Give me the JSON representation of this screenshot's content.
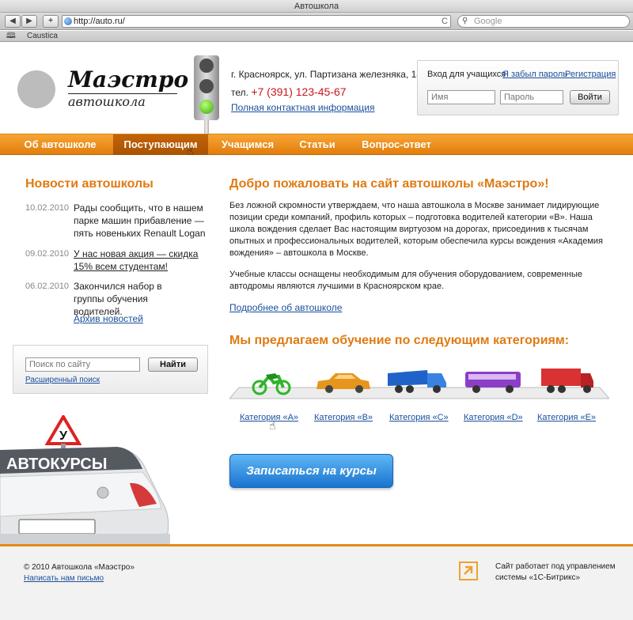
{
  "browser": {
    "window_title": "Автошкола",
    "back_glyph": "◀",
    "forward_glyph": "▶",
    "add_glyph": "+",
    "url": "http://auto.ru/",
    "reload_glyph": "C",
    "search_placeholder": "Google",
    "bookmark": "Caustica"
  },
  "header": {
    "logo_title": "Маэстро",
    "logo_subtitle": "автошкола",
    "address": "г. Красноярск, ул. Партизана железняка, 18",
    "phone_label": "тел.",
    "phone_number": "+7 (391) 123-45-67",
    "contacts_link": "Полная контактная информация"
  },
  "login": {
    "title": "Вход для учащихся",
    "forgot_link": "Я забыл пароль",
    "register_link": "Регистрация",
    "name_placeholder": "Имя",
    "password_placeholder": "Пароль",
    "submit_label": "Войти"
  },
  "nav": {
    "items": [
      {
        "label": "Об автошколе"
      },
      {
        "label": "Поступающим"
      },
      {
        "label": "Учащимся"
      },
      {
        "label": "Статьи"
      },
      {
        "label": "Вопрос-ответ"
      }
    ],
    "active_index": 1
  },
  "news": {
    "title": "Новости автошколы",
    "items": [
      {
        "date": "10.02.2010",
        "text": "Рады сообщить, что в нашем парке машин прибавление — пять новеньких Renault Logan"
      },
      {
        "date": "09.02.2010",
        "text": "У нас новая акция — скидка 15% всем студентам!"
      },
      {
        "date": "06.02.2010",
        "text": "Закончился набор в группы обучения водителей."
      }
    ],
    "archive_link": "Архив новостей"
  },
  "search": {
    "placeholder": "Поиск по сайту",
    "button": "Найти",
    "advanced_link": "Расширенный поиск"
  },
  "car": {
    "roof_sign": "У",
    "windshield_text": "АВТОКУРСЫ"
  },
  "main": {
    "welcome_title": "Добро пожаловать на сайт автошколы «Маэстро»!",
    "paragraph1": "Без ложной скромности утверждаем, что наша автошкола в Москве занимает лидирующие позиции среди компаний, профиль которых – подготовка водителей категории «В». Наша школа вождения сделает Вас настоящим виртуозом на дорогах, присоединив к тысячам опытных и профессиональных водителей, которым обеспечила курсы вождения «Академия вождения» – автошкола в Москве.",
    "paragraph2": "Учебные классы оснащены необходимым для обучения оборудованием, современные автодромы являются лучшими в Красноярском крае.",
    "more_link": "Подробнее об автошколе",
    "offer_title": "Мы предлагаем обучение по следующим категориям:",
    "categories": [
      {
        "label": "Категория «A»",
        "icon": "motorcycle-icon",
        "color": "#2fb52a"
      },
      {
        "label": "Категория «B»",
        "icon": "car-icon",
        "color": "#e6961c"
      },
      {
        "label": "Категория «C»",
        "icon": "truck-icon",
        "color": "#1f62c9"
      },
      {
        "label": "Категория «D»",
        "icon": "bus-icon",
        "color": "#8b3fc6"
      },
      {
        "label": "Категория «E»",
        "icon": "trailer-truck-icon",
        "color": "#d93232"
      }
    ],
    "enroll_button": "Записаться на курсы"
  },
  "footer": {
    "copyright": "© 2010 Автошкола «Маэстро»",
    "mail_link": "Написать нам письмо",
    "powered_by": "Сайт работает под управлением системы «1С-Битрикс»"
  },
  "colors": {
    "accent_orange": "#e07a12",
    "nav_orange": "#f0901f",
    "link_blue": "#1a4f9c",
    "phone_red": "#c8161d",
    "button_blue": "#2c8ae0"
  }
}
